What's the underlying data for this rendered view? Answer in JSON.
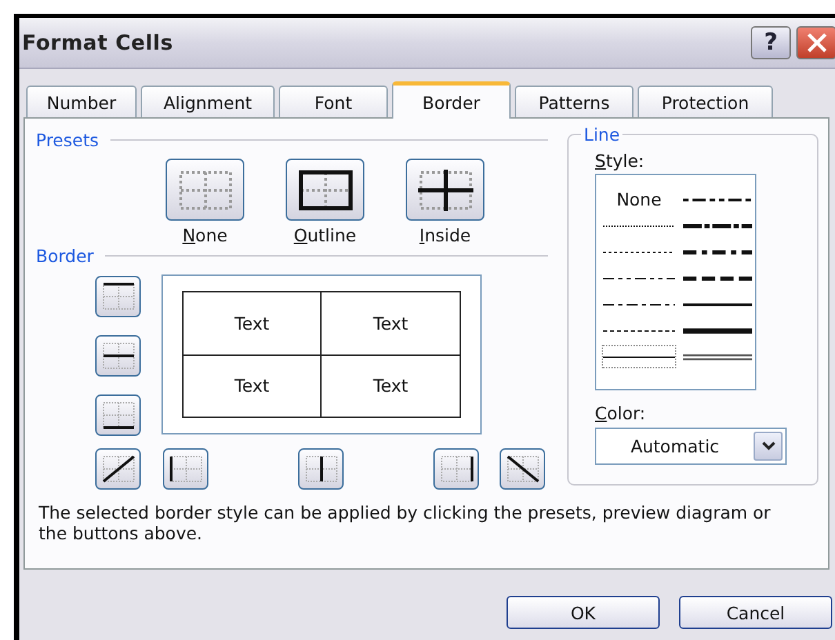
{
  "window": {
    "title": "Format Cells"
  },
  "title_buttons": [
    {
      "kind": "help",
      "label": "?"
    },
    {
      "kind": "close"
    }
  ],
  "tabs": [
    {
      "label": "Number",
      "selected": false
    },
    {
      "label": "Alignment",
      "selected": false
    },
    {
      "label": "Font",
      "selected": false
    },
    {
      "label": "Border",
      "selected": true
    },
    {
      "label": "Patterns",
      "selected": false
    },
    {
      "label": "Protection",
      "selected": false
    }
  ],
  "presets": {
    "label": "Presets",
    "items": [
      {
        "kind": "none",
        "label": "None"
      },
      {
        "kind": "outline",
        "label": "Outline"
      },
      {
        "kind": "inside",
        "label": "Inside"
      }
    ]
  },
  "border": {
    "label": "Border",
    "side_buttons": [
      {
        "kind": "top"
      },
      {
        "kind": "middle-h"
      },
      {
        "kind": "bottom"
      }
    ],
    "bottom_buttons": [
      {
        "kind": "diag-up"
      },
      {
        "kind": "left"
      },
      {
        "kind": "middle-v"
      },
      {
        "kind": "right"
      },
      {
        "kind": "diag-down"
      }
    ],
    "preview_cells": [
      "Text",
      "Text",
      "Text",
      "Text"
    ]
  },
  "line": {
    "label": "Line",
    "style_label": "Style:",
    "styles": [
      {
        "kind": "none",
        "label": "None",
        "selected": false
      },
      {
        "kind": "hair",
        "selected": false
      },
      {
        "kind": "dotted",
        "selected": false
      },
      {
        "kind": "dash-dot-dot",
        "selected": false
      },
      {
        "kind": "dash-dot",
        "selected": false
      },
      {
        "kind": "dashed",
        "selected": false
      },
      {
        "kind": "thin",
        "selected": true
      },
      {
        "kind": "medium-dash-dot-dot",
        "selected": false
      },
      {
        "kind": "slanted-dash-dot",
        "selected": false
      },
      {
        "kind": "medium-dash-dot",
        "selected": false
      },
      {
        "kind": "medium-dashed",
        "selected": false
      },
      {
        "kind": "medium",
        "selected": false
      },
      {
        "kind": "thick",
        "selected": false
      },
      {
        "kind": "double",
        "selected": false
      }
    ],
    "color_label": "Color:",
    "color_value": "Automatic"
  },
  "help_text": "The selected border style can be applied by clicking the presets, preview diagram or the buttons above.",
  "buttons": [
    {
      "label": "OK"
    },
    {
      "label": "Cancel"
    }
  ]
}
